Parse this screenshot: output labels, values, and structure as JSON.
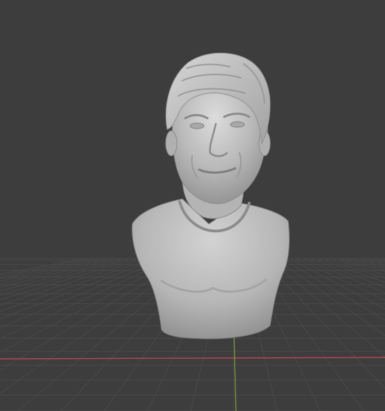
{
  "viewport": {
    "background_color": "#3d3d3d",
    "grid_color": "#4a4a4a",
    "x_axis_color": "#b8485a",
    "y_axis_color": "#7da13d"
  },
  "model": {
    "kind": "sculpted bust",
    "material_color": "#b9b9b9",
    "shading": "solid"
  }
}
